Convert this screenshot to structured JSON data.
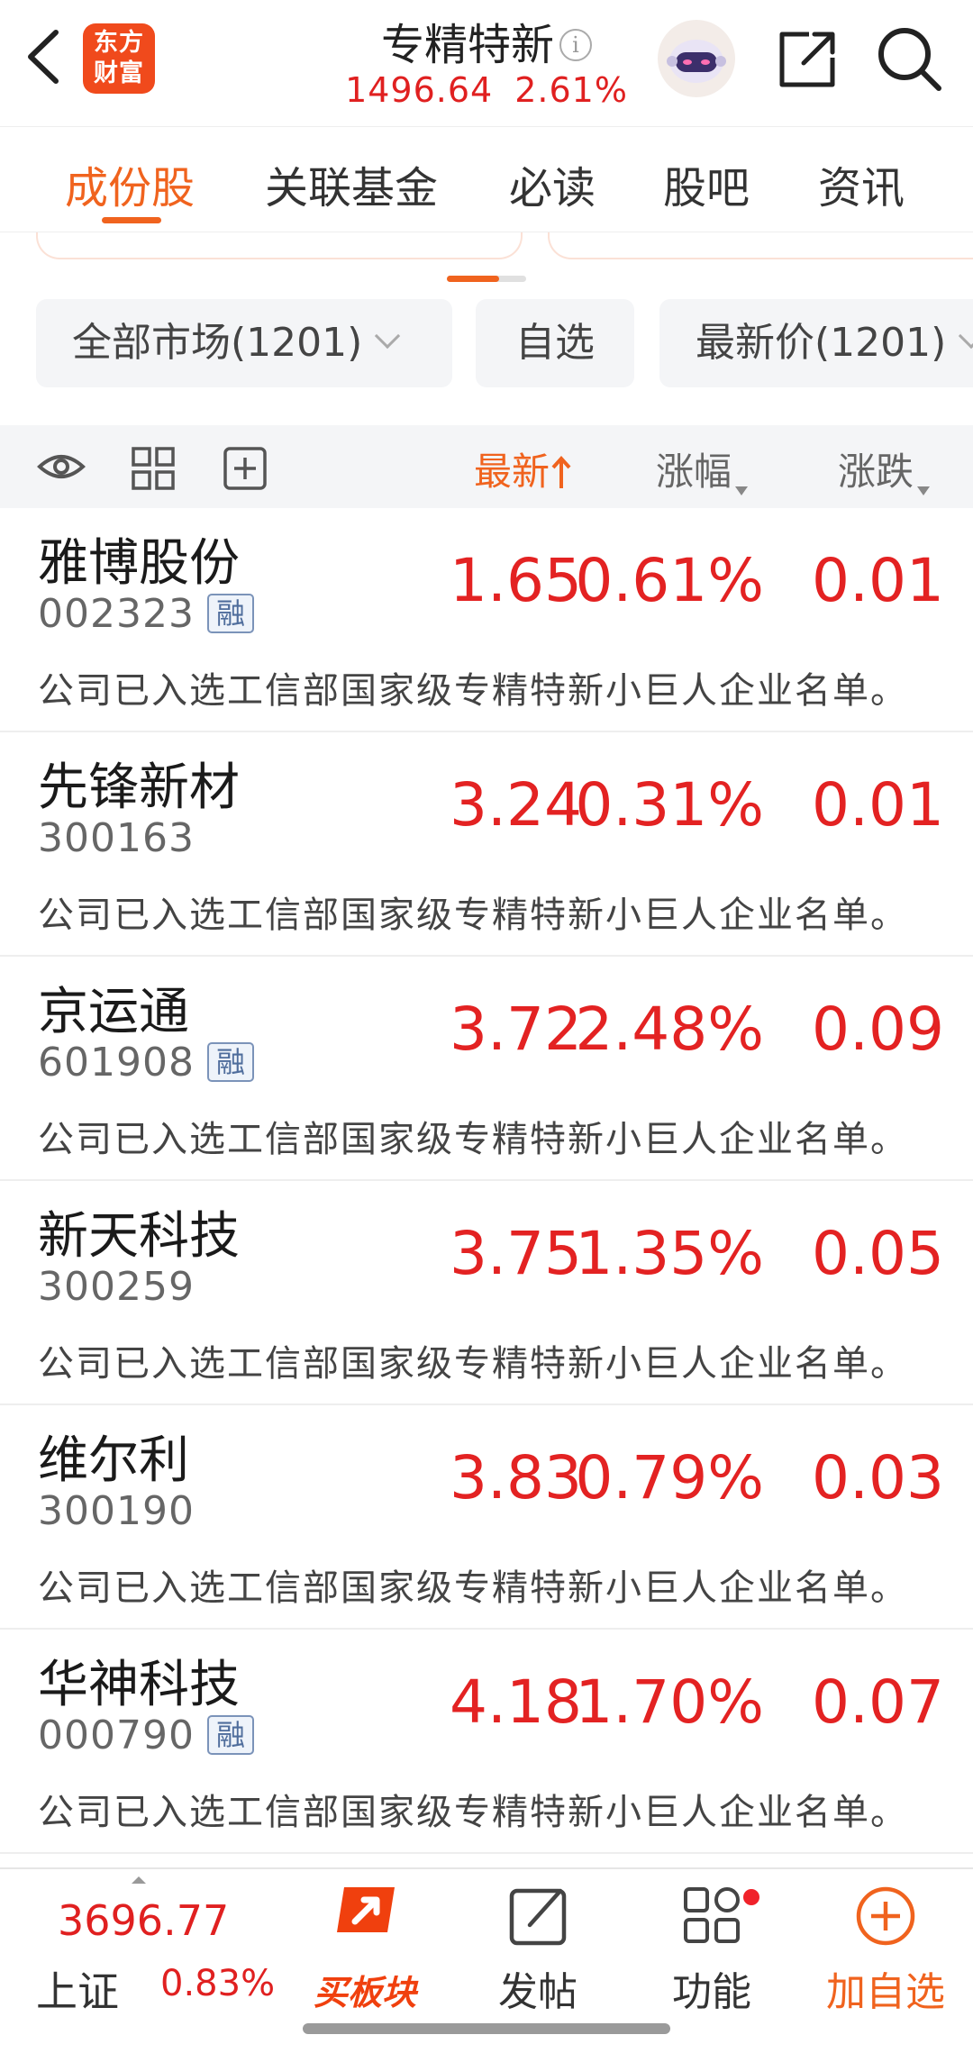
{
  "header": {
    "title": "专精特新",
    "info_icon": "info-icon",
    "index_value": "1496.64",
    "index_change_pct": "2.61%",
    "logo_line1": "东方",
    "logo_line2": "财富",
    "accent_color": "#f0631e",
    "up_color": "#e32222"
  },
  "tabs": [
    "成份股",
    "关联基金",
    "必读",
    "股吧",
    "资讯"
  ],
  "active_tab": "成份股",
  "filters": {
    "market": "全部市场(1201)",
    "watchlist": "自选",
    "sort": "最新价(1201)"
  },
  "columns": {
    "latest": "最新",
    "pct": "涨幅",
    "change": "涨跌"
  },
  "stocks": [
    {
      "name": "雅博股份",
      "code": "002323",
      "margin": "融",
      "price": "1.65",
      "pct": "0.61%",
      "change": "0.01",
      "desc": "公司已入选工信部国家级专精特新小巨人企业名单。"
    },
    {
      "name": "先锋新材",
      "code": "300163",
      "margin": "",
      "price": "3.24",
      "pct": "0.31%",
      "change": "0.01",
      "desc": "公司已入选工信部国家级专精特新小巨人企业名单。"
    },
    {
      "name": "京运通",
      "code": "601908",
      "margin": "融",
      "price": "3.72",
      "pct": "2.48%",
      "change": "0.09",
      "desc": "公司已入选工信部国家级专精特新小巨人企业名单。"
    },
    {
      "name": "新天科技",
      "code": "300259",
      "margin": "",
      "price": "3.75",
      "pct": "1.35%",
      "change": "0.05",
      "desc": "公司已入选工信部国家级专精特新小巨人企业名单。"
    },
    {
      "name": "维尔利",
      "code": "300190",
      "margin": "",
      "price": "3.83",
      "pct": "0.79%",
      "change": "0.03",
      "desc": "公司已入选工信部国家级专精特新小巨人企业名单。"
    },
    {
      "name": "华神科技",
      "code": "000790",
      "margin": "融",
      "price": "4.18",
      "pct": "1.70%",
      "change": "0.07",
      "desc": "公司已入选工信部国家级专精特新小巨人企业名单。"
    }
  ],
  "bottom_bar": {
    "index_name": "上证",
    "index_value": "3696.77",
    "index_pct": "0.83%",
    "buy_block": "买板块",
    "post": "发帖",
    "functions": "功能",
    "add_watch": "加自选"
  }
}
